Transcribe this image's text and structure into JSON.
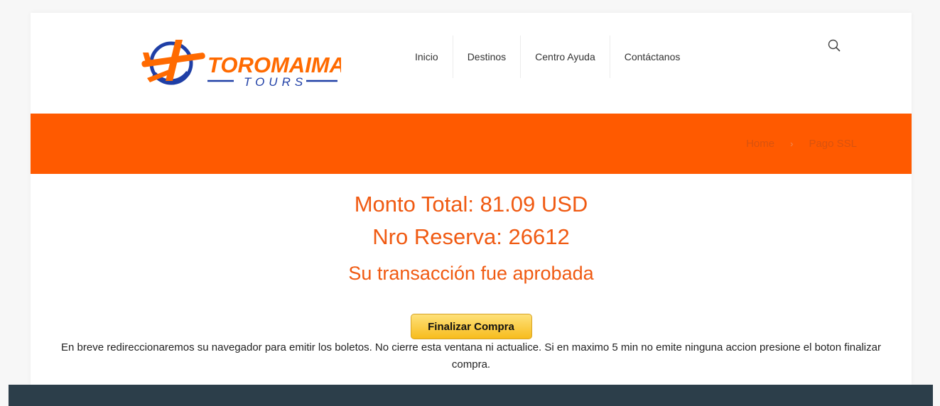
{
  "brand": {
    "name": "TOROMAIMA",
    "tagline": "TOURS"
  },
  "nav": {
    "items": [
      {
        "label": "Inicio"
      },
      {
        "label": "Destinos"
      },
      {
        "label": "Centro Ayuda"
      },
      {
        "label": "Contáctanos"
      }
    ]
  },
  "breadcrumb": {
    "home": "Home",
    "separator": "›",
    "current": "Pago SSL"
  },
  "payment": {
    "amount": "Monto Total: 81.09 USD",
    "reservation": "Nro Reserva: 26612",
    "status": "Su transacción fue aprobada",
    "button_label": "Finalizar Compra",
    "info": "En breve redireccionaremos su navegador para emitir los boletos. No cierre esta ventana ni actualice. Si en maximo 5 min no emite ninguna accion presione el boton finalizar compra."
  },
  "icons": {
    "search": "search-icon",
    "logo": "airplane-globe-icon"
  },
  "colors": {
    "accent": "#ff5a00",
    "brand_blue": "#1f3fa6",
    "footer": "#2c3e4a"
  }
}
